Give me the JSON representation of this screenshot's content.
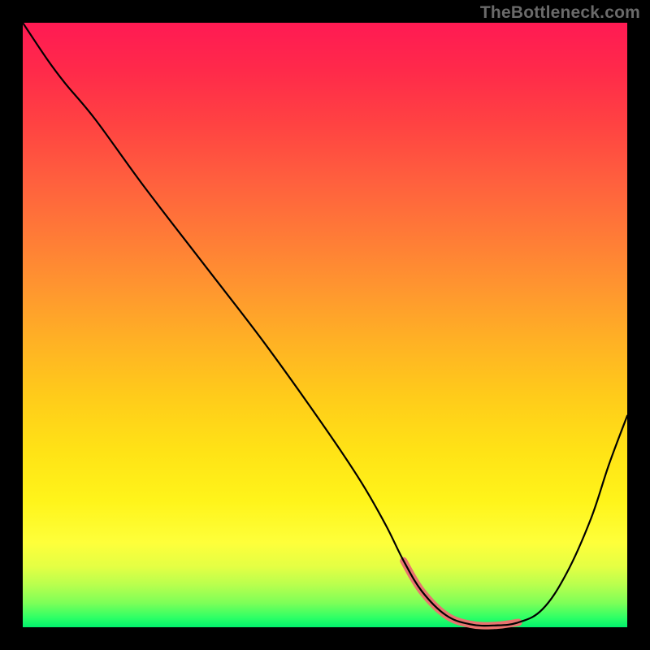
{
  "watermark": "TheBottleneck.com",
  "chart_data": {
    "type": "line",
    "title": "",
    "xlabel": "",
    "ylabel": "",
    "xlim": [
      0,
      100
    ],
    "ylim": [
      0,
      100
    ],
    "grid": false,
    "legend": false,
    "series": [
      {
        "name": "curve",
        "x": [
          0,
          4,
          7,
          12,
          20,
          30,
          40,
          50,
          56,
          60,
          63,
          66,
          70,
          74,
          78,
          82,
          86,
          90,
          94,
          97,
          100
        ],
        "y": [
          100,
          94,
          90,
          84,
          73,
          60,
          47,
          33,
          24,
          17,
          11,
          6,
          2,
          0.5,
          0.3,
          0.8,
          3,
          9,
          18,
          27,
          35
        ]
      },
      {
        "name": "highlight",
        "x": [
          63,
          66,
          70,
          74,
          78,
          82
        ],
        "y": [
          11,
          6,
          2,
          0.5,
          0.3,
          0.8
        ]
      }
    ],
    "colors": {
      "background_gradient_top": "#ff1a53",
      "background_gradient_bottom": "#00f06c",
      "curve": "#000000",
      "highlight": "#e8736f",
      "frame": "#000000"
    }
  }
}
